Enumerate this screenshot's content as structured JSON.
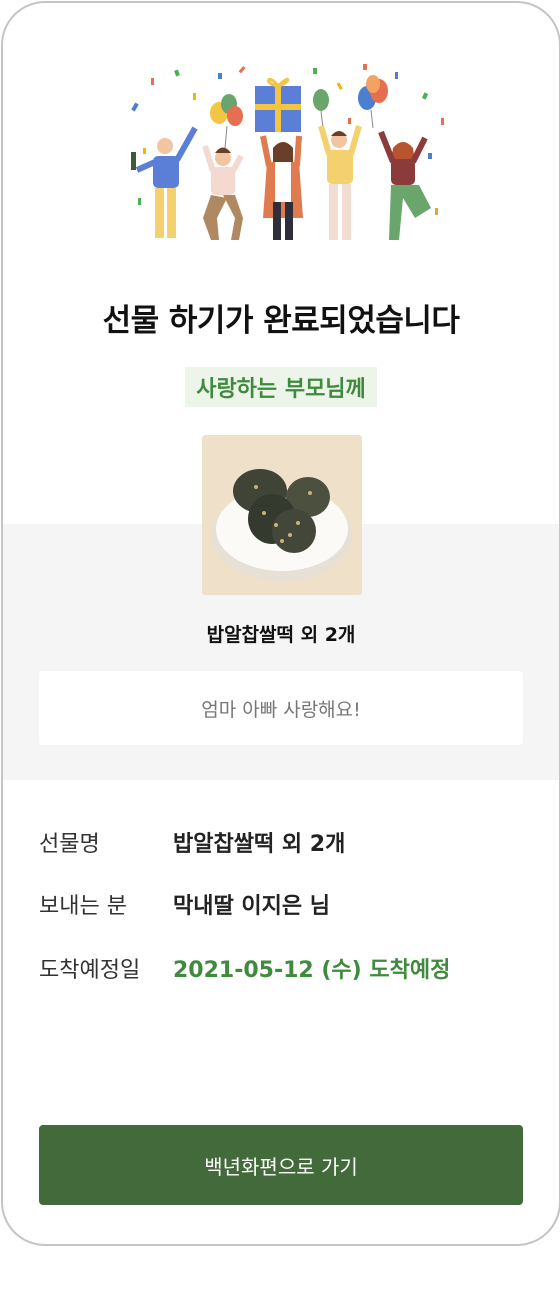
{
  "complete_title": "선물 하기가 완료되었습니다",
  "recipient_label": "사랑하는 부모님께",
  "product": {
    "name": "밥알찹쌀떡 외 2개",
    "image_icon": "rice-cake-image"
  },
  "message": "엄마 아빠 사랑해요!",
  "details": [
    {
      "label": "선물명",
      "value": "밥알찹쌀떡 외 2개"
    },
    {
      "label": "보내는 분",
      "value": "막내딸 이지은 님"
    },
    {
      "label": "도착예정일",
      "value": "2021-05-12 (수) 도착예정"
    }
  ],
  "button_label": "백년화편으로 가기",
  "colors": {
    "accent_green": "#3f8a3c",
    "button_green": "#436a3b",
    "badge_bg": "#edf5ea",
    "band_gray": "#f5f5f5"
  }
}
